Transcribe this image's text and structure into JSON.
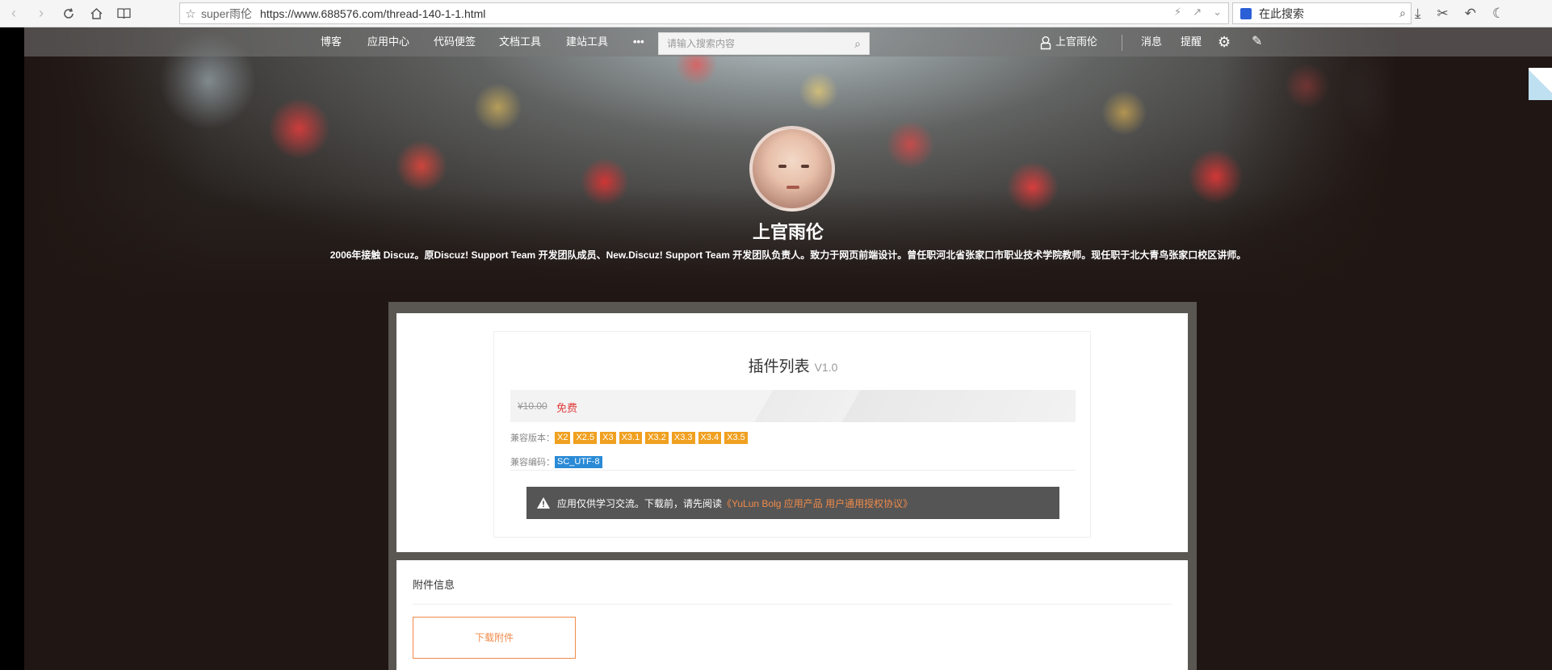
{
  "browser": {
    "site_name": "super雨伦",
    "url": "https://www.688576.com/thread-140-1-1.html",
    "search_placeholder": "在此搜索"
  },
  "nav": {
    "items": [
      "博客",
      "应用中心",
      "代码便签",
      "文档工具",
      "建站工具"
    ],
    "more": "•••",
    "search_placeholder": "请输入搜索内容",
    "user": "上官雨伦",
    "messages": "消息",
    "reminders": "提醒"
  },
  "profile": {
    "name": "上官雨伦",
    "bio": "2006年接触 Discuz。原Discuz! Support Team 开发团队成员、New.Discuz! Support Team 开发团队负责人。致力于网页前端设计。曾任职河北省张家口市职业技术学院教师。现任职于北大青鸟张家口校区讲师。"
  },
  "plugin": {
    "title": "插件列表",
    "version": "V1.0",
    "price_old": "¥10.00",
    "price_new": "免费",
    "compat_version_label": "兼容版本：",
    "versions": [
      "X2",
      "X2.5",
      "X3",
      "X3.1",
      "X3.2",
      "X3.3",
      "X3.4",
      "X3.5"
    ],
    "compat_encoding_label": "兼容编码：",
    "encodings": [
      "SC_UTF-8"
    ],
    "notice_text": "应用仅供学习交流。下载前，请先阅读",
    "notice_link": "《YuLun Bolg 应用产品 用户通用授权协议》"
  },
  "attachment": {
    "title": "附件信息",
    "download_label": "下载附件"
  },
  "colors": {
    "accent": "#f08a4a",
    "tag_orange": "#f0a020",
    "tag_blue": "#2a8ad6",
    "price_red": "#e03c3c"
  }
}
